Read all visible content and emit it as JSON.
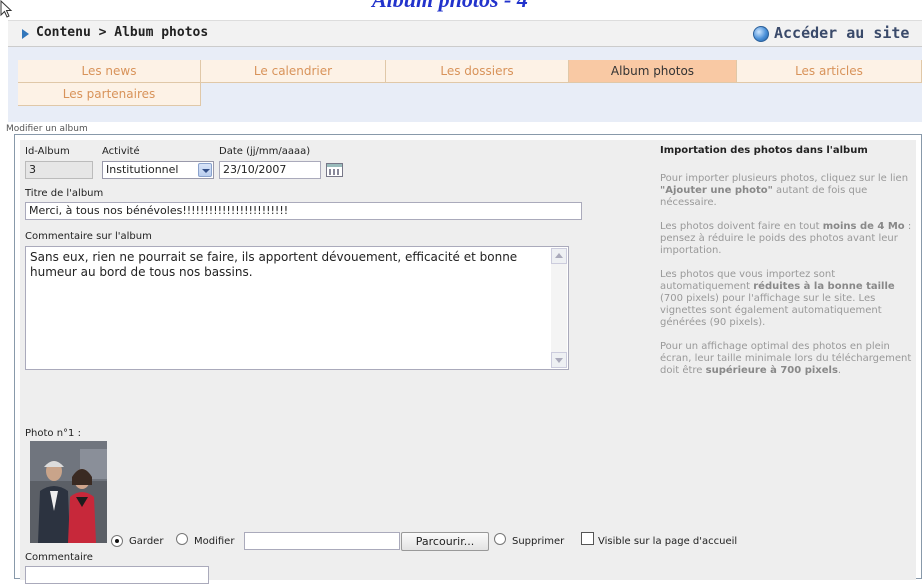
{
  "page_title": "Album photos - 4",
  "header": {
    "breadcrumb": "Contenu > Album photos",
    "access_link": "Accéder au site"
  },
  "tabs": [
    {
      "label": "Les news",
      "active": false
    },
    {
      "label": "Le calendrier",
      "active": false
    },
    {
      "label": "Les dossiers",
      "active": false
    },
    {
      "label": "Album photos",
      "active": true
    },
    {
      "label": "Les articles",
      "active": false
    },
    {
      "label": "Les partenaires",
      "active": false
    }
  ],
  "subtitle": "Modifier un album",
  "form": {
    "id_label": "Id-Album",
    "id_value": "3",
    "activity_label": "Activité",
    "activity_value": "Institutionnel",
    "date_label": "Date (jj/mm/aaaa)",
    "date_value": "23/10/2007",
    "title_label": "Titre de l'album",
    "title_value": "Merci, à tous nos bénévoles!!!!!!!!!!!!!!!!!!!!!!!!",
    "comment_label": "Commentaire sur l'album",
    "comment_value": "Sans eux, rien ne pourrait se faire, ils apportent dévouement, efficacité et bonne humeur au bord de tous nos bassins."
  },
  "help": {
    "title": "Importation des photos dans l'album",
    "p1_a": "Pour importer plusieurs photos, cliquez sur le lien ",
    "p1_b": "\"Ajouter une photo\"",
    "p1_c": " autant de fois que nécessaire.",
    "p2_a": "Les photos doivent faire en tout ",
    "p2_b": "moins de 4 Mo",
    "p2_c": " : pensez à réduire le poids des photos avant leur importation.",
    "p3_a": "Les photos que vous importez sont automatiquement ",
    "p3_b": "réduites à la bonne taille",
    "p3_c": " (700 pixels) pour l'affichage sur le site. Les vignettes sont également automatiquement générées (90 pixels).",
    "p4_a": "Pour un affichage optimal des photos en plein écran, leur taille minimale lors du téléchargement doit être ",
    "p4_b": "supérieure à 700 pixels",
    "p4_c": "."
  },
  "photo": {
    "label": "Photo n°1 :",
    "keep_label": "Garder",
    "modify_label": "Modifier",
    "browse_label": "Parcourir...",
    "delete_label": "Supprimer",
    "visible_label": "Visible sur la page d'accueil",
    "comment_label": "Commentaire",
    "selected_option": "Garder",
    "visible_checked": false
  }
}
